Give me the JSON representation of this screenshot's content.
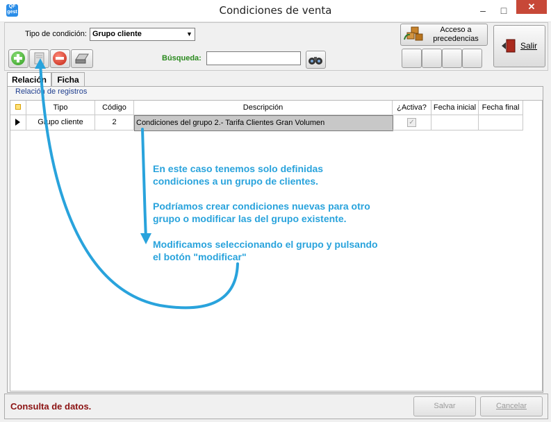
{
  "window": {
    "title": "Condiciones de venta",
    "app_icon_text": "QF\ngest",
    "minimize": "–",
    "maximize": "□",
    "close": "✕"
  },
  "filter": {
    "label": "Tipo de condición:",
    "value": "Grupo cliente"
  },
  "search": {
    "label": "Búsqueda:",
    "value": ""
  },
  "buttons": {
    "precedences_line1": "Acceso a",
    "precedences_line2": "precedencias",
    "exit": "Salir",
    "save": "Salvar",
    "cancel": "Cancelar"
  },
  "tabs": [
    {
      "label": "Relación",
      "active": true
    },
    {
      "label": "Ficha",
      "active": false
    }
  ],
  "group_title": "Relación de registros",
  "table": {
    "columns": [
      "Tipo",
      "Código",
      "Descripción",
      "¿Activa?",
      "Fecha inicial",
      "Fecha final"
    ],
    "rows": [
      {
        "tipo": "Grupo cliente",
        "codigo": "2",
        "descripcion": "Condiciones del grupo 2.- Tarifa Clientes Gran Volumen",
        "activa": true,
        "fecha_inicial": "",
        "fecha_final": ""
      }
    ]
  },
  "annotations": [
    [
      "En este caso tenemos solo definidas",
      "condiciones a un grupo de clientes."
    ],
    [
      "Podríamos crear condiciones nuevas para otro",
      "grupo o modificar las del grupo existente."
    ],
    [
      "Modificamos seleccionando el grupo y pulsando",
      "el botón \"modificar\""
    ]
  ],
  "status": "Consulta de datos.",
  "colors": {
    "annotation": "#29a3dc",
    "status_text": "#8b1212",
    "search_label": "#2a8a1e",
    "close_button": "#c74838"
  }
}
